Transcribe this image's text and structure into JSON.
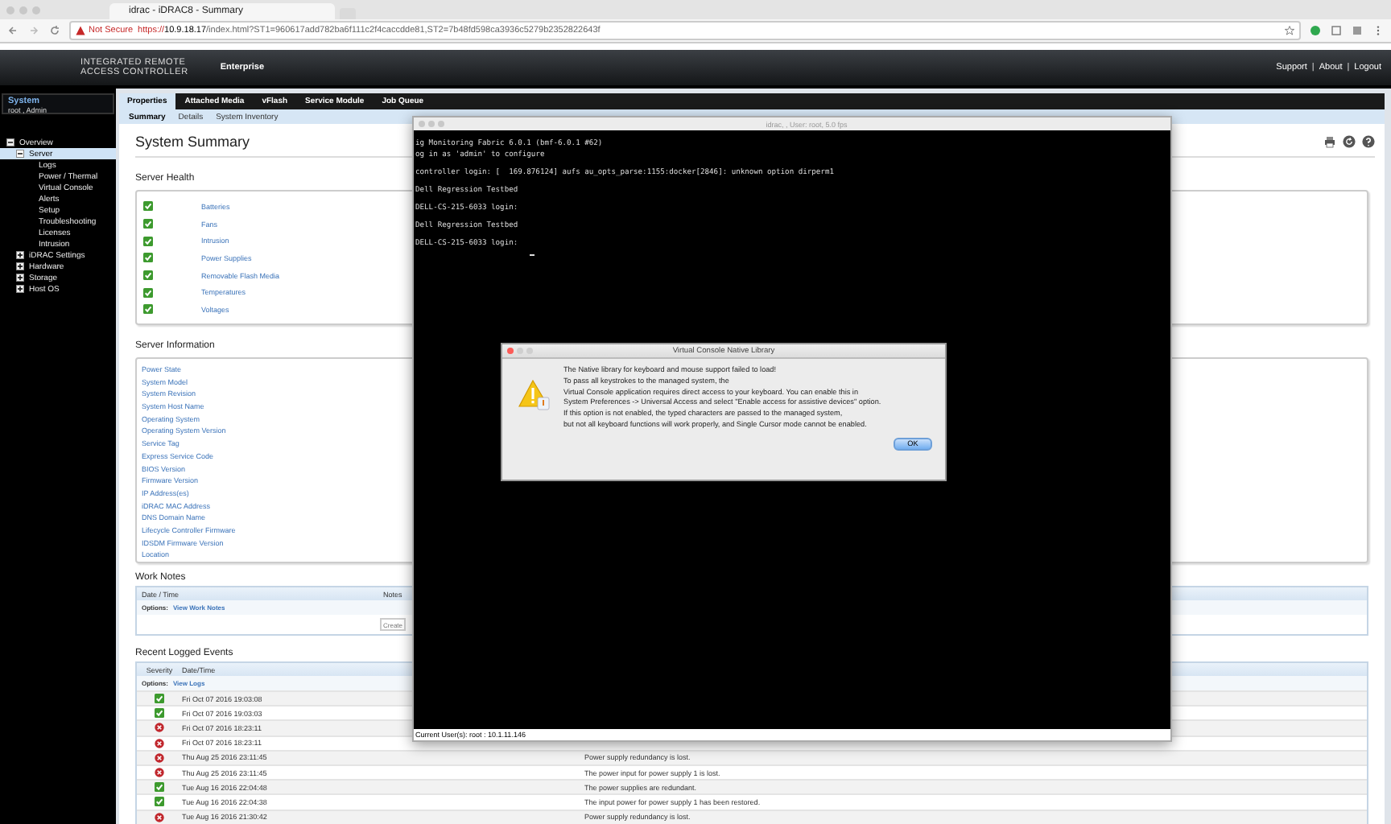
{
  "browser": {
    "tab_title": "idrac - iDRAC8 - Summary",
    "security": "Not Secure",
    "url_scheme": "https://",
    "url_host": "10.9.18.17",
    "url_path": "/index.html?ST1=960617add782ba6f111c2f4caccdde81,ST2=7b48fd598ca3936c5279b2352822643f"
  },
  "header": {
    "product_line1": "INTEGRATED REMOTE",
    "product_line2": "ACCESS CONTROLLER",
    "edition": "Enterprise",
    "links": [
      "Support",
      "About",
      "Logout"
    ],
    "separators": [
      "|",
      "|"
    ]
  },
  "sidebar": {
    "title": "System",
    "user": "root , Admin",
    "tree": [
      {
        "label": "Overview",
        "expanded": true,
        "selected": false,
        "children": [
          {
            "label": "Server",
            "expanded": true,
            "selected": true,
            "children": [
              {
                "label": "Logs",
                "selected": false
              },
              {
                "label": "Power / Thermal",
                "selected": false
              },
              {
                "label": "Virtual Console",
                "selected": false
              },
              {
                "label": "Alerts",
                "selected": false
              },
              {
                "label": "Setup",
                "selected": false
              },
              {
                "label": "Troubleshooting",
                "selected": false
              },
              {
                "label": "Licenses",
                "selected": false
              },
              {
                "label": "Intrusion",
                "selected": false
              }
            ]
          },
          {
            "label": "iDRAC Settings",
            "expanded": false,
            "selected": false
          },
          {
            "label": "Hardware",
            "expanded": false,
            "selected": false
          },
          {
            "label": "Storage",
            "expanded": false,
            "selected": false
          },
          {
            "label": "Host OS",
            "expanded": false,
            "selected": false
          }
        ]
      }
    ]
  },
  "tabs": [
    {
      "label": "Properties",
      "selected": true
    },
    {
      "label": "Attached Media",
      "selected": false
    },
    {
      "label": "vFlash",
      "selected": false
    },
    {
      "label": "Service Module",
      "selected": false
    },
    {
      "label": "Job Queue",
      "selected": false
    }
  ],
  "subtabs": [
    {
      "label": "Summary",
      "selected": true
    },
    {
      "label": "Details",
      "selected": false
    },
    {
      "label": "System Inventory",
      "selected": false
    }
  ],
  "page_title": "System Summary",
  "server_health": {
    "title": "Server Health",
    "items": [
      {
        "label": "Batteries",
        "kind": "ok"
      },
      {
        "label": "Fans",
        "kind": "ok"
      },
      {
        "label": "Intrusion",
        "kind": "ok"
      },
      {
        "label": "Power Supplies",
        "kind": "ok"
      },
      {
        "label": "Removable Flash Media",
        "kind": "ok"
      },
      {
        "label": "Temperatures",
        "kind": "ok"
      },
      {
        "label": "Voltages",
        "kind": "ok"
      }
    ]
  },
  "server_information": {
    "title": "Server Information",
    "items": [
      "Power State",
      "System Model",
      "System Revision",
      "System Host Name",
      "Operating System",
      "Operating System Version",
      "Service Tag",
      "Express Service Code",
      "BIOS Version",
      "Firmware Version",
      "IP Address(es)",
      "iDRAC MAC Address",
      "DNS Domain Name",
      "Lifecycle Controller Firmware",
      "IDSDM Firmware Version",
      "Location"
    ]
  },
  "work_notes": {
    "title": "Work Notes",
    "columns": [
      "Date / Time",
      "Notes"
    ],
    "options_label": "Options:",
    "options_link": "View Work Notes",
    "placeholder": "Create"
  },
  "events": {
    "title": "Recent Logged Events",
    "columns": [
      "Severity",
      "Date/Time"
    ],
    "options_label": "Options:",
    "options_link": "View Logs",
    "rows": [
      {
        "kind": "ok",
        "date": "Fri Oct 07 2016 19:03:08"
      },
      {
        "kind": "ok",
        "date": "Fri Oct 07 2016 19:03:03"
      },
      {
        "kind": "critical",
        "date": "Fri Oct 07 2016 18:23:11"
      },
      {
        "kind": "critical",
        "date": "Fri Oct 07 2016 18:23:11"
      },
      {
        "kind": "critical",
        "date": "Thu Aug 25 2016 23:11:45",
        "message": "Power supply redundancy is lost."
      },
      {
        "kind": "critical",
        "date": "Thu Aug 25 2016 23:11:45",
        "message": "The power input for power supply 1 is lost."
      },
      {
        "kind": "ok",
        "date": "Tue Aug 16 2016 22:04:48",
        "message": "The power supplies are redundant."
      },
      {
        "kind": "ok",
        "date": "Tue Aug 16 2016 22:04:38",
        "message": "The input power for power supply 1 has been restored."
      },
      {
        "kind": "critical",
        "date": "Tue Aug 16 2016 21:30:42",
        "message": "Power supply redundancy is lost."
      }
    ]
  },
  "console": {
    "title": "idrac, , User: root, 5.0 fps",
    "blocks": [
      [
        "ig Monitoring Fabric 6.0.1 (bmf-6.0.1 #62)",
        "og in as 'admin' to configure"
      ],
      [
        "controller login: [  169.876124] aufs au_opts_parse:1155:docker[2846]: unknown option dirperm1"
      ],
      [
        "Dell Regression Testbed"
      ],
      [
        "DELL-CS-215-6033 login:"
      ],
      [
        "Dell Regression Testbed"
      ],
      [
        "DELL-CS-215-6033 login:"
      ]
    ],
    "footer": "Current User(s): root : 10.1.11.146"
  },
  "dialog": {
    "title": "Virtual Console Native Library",
    "message_lines": [
      "The Native library for keyboard and mouse support failed to load!",
      "To pass all keystrokes to the managed system, the",
      "Virtual Console application requires  direct access to your keyboard.  You can enable this in",
      "System Preferences -> Universal Access and select \"Enable access for assistive devices\" option.",
      "If this option is not enabled, the typed characters are passed to the managed system,",
      "but not all keyboard functions will work properly, and Single Cursor mode cannot be enabled."
    ],
    "button": "OK"
  }
}
